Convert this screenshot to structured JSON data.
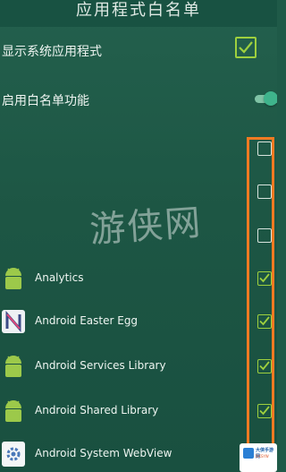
{
  "header": {
    "title": "应用程式白名单"
  },
  "settings": {
    "show_system_apps": {
      "label": "显示系统应用程式",
      "checked": true
    },
    "enable_whitelist": {
      "label": "启用白名单功能",
      "enabled": true
    }
  },
  "apps": [
    {
      "name": "Analytics",
      "icon": "android-robot-icon",
      "checked": true
    },
    {
      "name": "Android Easter Egg",
      "icon": "android-n-icon",
      "checked": true
    },
    {
      "name": "Android Services Library",
      "icon": "android-robot-icon",
      "checked": true
    },
    {
      "name": "Android Shared Library",
      "icon": "android-robot-icon",
      "checked": true
    },
    {
      "name": "Android System WebView",
      "icon": "webview-gear-icon",
      "checked": false
    }
  ],
  "empty_rows": [
    {
      "checked": false
    },
    {
      "checked": false
    },
    {
      "checked": false
    }
  ],
  "watermark": {
    "text": "游侠网"
  },
  "logo": {
    "line1": "大侠手游网",
    "line2": "DXSYW"
  },
  "colors": {
    "background": "#1f5a48",
    "accent_check": "#9ed03e",
    "toggle": "#3fb48c",
    "highlight": "#f07a22"
  }
}
